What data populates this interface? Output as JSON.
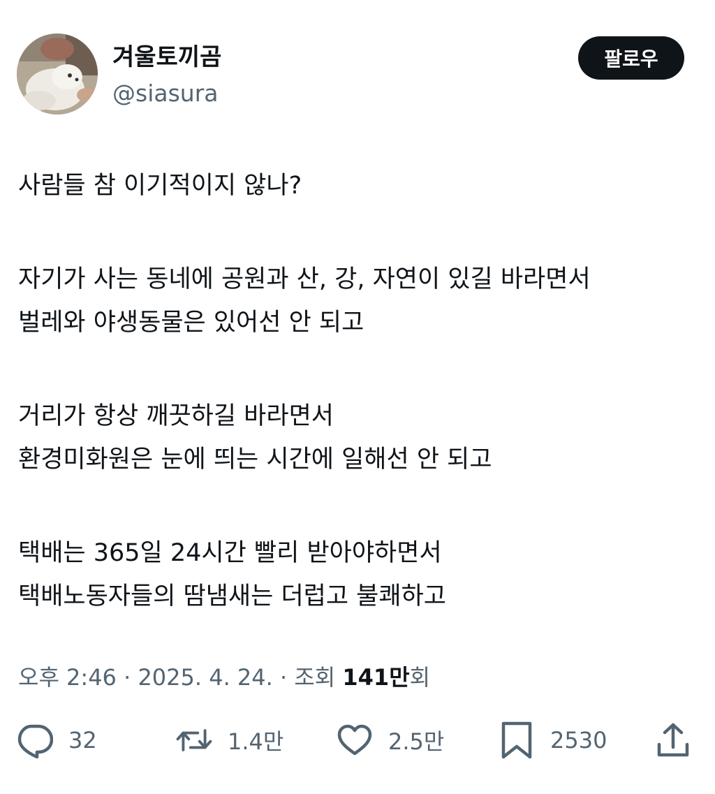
{
  "author": {
    "display_name": "겨울토끼곰",
    "handle": "@siasura"
  },
  "follow_button": {
    "label": "팔로우"
  },
  "tweet": {
    "lines": [
      "사람들 참 이기적이지 않나?",
      "자기가 사는 동네에 공원과 산, 강, 자연이 있길 바라면서",
      "벌레와 야생동물은 있어선 안 되고",
      "거리가 항상 깨끗하길 바라면서",
      "환경미화원은 눈에 띄는 시간에 일해선 안 되고",
      "택배는 365일 24시간 빨리 받아야하면서",
      "택배노동자들의 땀냄새는 더럽고 불쾌하고"
    ]
  },
  "meta": {
    "time": "오후 2:46",
    "separator": " · ",
    "date": "2025. 4. 24.",
    "views_label": "조회 ",
    "views_count": "141만",
    "views_suffix": "회"
  },
  "actions": {
    "reply": {
      "icon": "reply-icon",
      "count": "32"
    },
    "retweet": {
      "icon": "retweet-icon",
      "count": "1.4만"
    },
    "like": {
      "icon": "heart-icon",
      "count": "2.5만"
    },
    "bookmark": {
      "icon": "bookmark-icon",
      "count": "2530"
    },
    "share": {
      "icon": "share-icon"
    }
  },
  "colors": {
    "text_primary": "#0f1419",
    "text_secondary": "#536471",
    "button_bg": "#0f1419",
    "button_text": "#ffffff"
  }
}
